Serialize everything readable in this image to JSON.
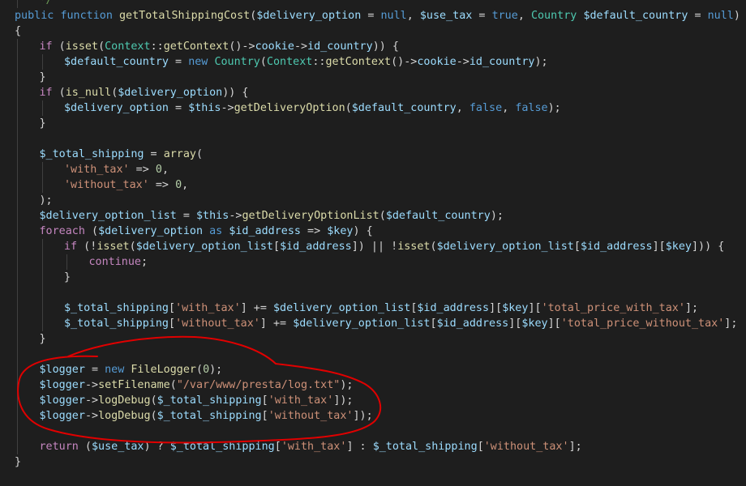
{
  "editor": {
    "theme": "dark",
    "background": "#1e1e1e",
    "colors": {
      "keyword": "#569cd6",
      "function": "#dcdcaa",
      "variable": "#9cdcfe",
      "class": "#4ec9b0",
      "string": "#ce9178",
      "number": "#b5cea8",
      "comment": "#6a9955",
      "annotation_stroke": "#e00000"
    },
    "lines": [
      {
        "indent": 1,
        "guides": [
          1
        ],
        "tokens": [
          [
            "cmt",
            "*/"
          ]
        ]
      },
      {
        "indent": 0,
        "guides": [],
        "tokens": [
          [
            "kw",
            "public"
          ],
          [
            "pl",
            " "
          ],
          [
            "kw",
            "function"
          ],
          [
            "pl",
            " "
          ],
          [
            "fn",
            "getTotalShippingCost"
          ],
          [
            "pl",
            "("
          ],
          [
            "var",
            "$delivery_option"
          ],
          [
            "pl",
            " = "
          ],
          [
            "kw",
            "null"
          ],
          [
            "pl",
            ", "
          ],
          [
            "var",
            "$use_tax"
          ],
          [
            "pl",
            " = "
          ],
          [
            "kw",
            "true"
          ],
          [
            "pl",
            ", "
          ],
          [
            "cls",
            "Country"
          ],
          [
            "pl",
            " "
          ],
          [
            "var",
            "$default_country"
          ],
          [
            "pl",
            " = "
          ],
          [
            "kw",
            "null"
          ],
          [
            "pl",
            ")"
          ]
        ]
      },
      {
        "indent": 0,
        "guides": [],
        "tokens": [
          [
            "pl",
            "{"
          ]
        ]
      },
      {
        "indent": 1,
        "guides": [
          1
        ],
        "tokens": [
          [
            "ctl",
            "if"
          ],
          [
            "pl",
            " ("
          ],
          [
            "fn",
            "isset"
          ],
          [
            "pl",
            "("
          ],
          [
            "cls",
            "Context"
          ],
          [
            "pl",
            "::"
          ],
          [
            "fn",
            "getContext"
          ],
          [
            "pl",
            "()->"
          ],
          [
            "var",
            "cookie"
          ],
          [
            "pl",
            "->"
          ],
          [
            "var",
            "id_country"
          ],
          [
            "pl",
            ")) {"
          ]
        ]
      },
      {
        "indent": 2,
        "guides": [
          1,
          2
        ],
        "tokens": [
          [
            "var",
            "$default_country"
          ],
          [
            "pl",
            " = "
          ],
          [
            "kw",
            "new"
          ],
          [
            "pl",
            " "
          ],
          [
            "cls",
            "Country"
          ],
          [
            "pl",
            "("
          ],
          [
            "cls",
            "Context"
          ],
          [
            "pl",
            "::"
          ],
          [
            "fn",
            "getContext"
          ],
          [
            "pl",
            "()->"
          ],
          [
            "var",
            "cookie"
          ],
          [
            "pl",
            "->"
          ],
          [
            "var",
            "id_country"
          ],
          [
            "pl",
            ");"
          ]
        ]
      },
      {
        "indent": 1,
        "guides": [
          1
        ],
        "tokens": [
          [
            "pl",
            "}"
          ]
        ]
      },
      {
        "indent": 1,
        "guides": [
          1
        ],
        "tokens": [
          [
            "ctl",
            "if"
          ],
          [
            "pl",
            " ("
          ],
          [
            "fn",
            "is_null"
          ],
          [
            "pl",
            "("
          ],
          [
            "var",
            "$delivery_option"
          ],
          [
            "pl",
            ")) {"
          ]
        ]
      },
      {
        "indent": 2,
        "guides": [
          1,
          2
        ],
        "tokens": [
          [
            "var",
            "$delivery_option"
          ],
          [
            "pl",
            " = "
          ],
          [
            "var",
            "$this"
          ],
          [
            "pl",
            "->"
          ],
          [
            "fn",
            "getDeliveryOption"
          ],
          [
            "pl",
            "("
          ],
          [
            "var",
            "$default_country"
          ],
          [
            "pl",
            ", "
          ],
          [
            "kw",
            "false"
          ],
          [
            "pl",
            ", "
          ],
          [
            "kw",
            "false"
          ],
          [
            "pl",
            ");"
          ]
        ]
      },
      {
        "indent": 1,
        "guides": [
          1
        ],
        "tokens": [
          [
            "pl",
            "}"
          ]
        ]
      },
      {
        "indent": 0,
        "guides": [
          1
        ],
        "tokens": []
      },
      {
        "indent": 1,
        "guides": [
          1
        ],
        "tokens": [
          [
            "var",
            "$_total_shipping"
          ],
          [
            "pl",
            " = "
          ],
          [
            "fn",
            "array"
          ],
          [
            "pl",
            "("
          ]
        ]
      },
      {
        "indent": 2,
        "guides": [
          1,
          2
        ],
        "tokens": [
          [
            "str",
            "'with_tax'"
          ],
          [
            "pl",
            " => "
          ],
          [
            "num",
            "0"
          ],
          [
            "pl",
            ","
          ]
        ]
      },
      {
        "indent": 2,
        "guides": [
          1,
          2
        ],
        "tokens": [
          [
            "str",
            "'without_tax'"
          ],
          [
            "pl",
            " => "
          ],
          [
            "num",
            "0"
          ],
          [
            "pl",
            ","
          ]
        ]
      },
      {
        "indent": 1,
        "guides": [
          1
        ],
        "tokens": [
          [
            "pl",
            ");"
          ]
        ]
      },
      {
        "indent": 1,
        "guides": [
          1
        ],
        "tokens": [
          [
            "var",
            "$delivery_option_list"
          ],
          [
            "pl",
            " = "
          ],
          [
            "var",
            "$this"
          ],
          [
            "pl",
            "->"
          ],
          [
            "fn",
            "getDeliveryOptionList"
          ],
          [
            "pl",
            "("
          ],
          [
            "var",
            "$default_country"
          ],
          [
            "pl",
            ");"
          ]
        ]
      },
      {
        "indent": 1,
        "guides": [
          1
        ],
        "tokens": [
          [
            "ctl",
            "foreach"
          ],
          [
            "pl",
            " ("
          ],
          [
            "var",
            "$delivery_option"
          ],
          [
            "pl",
            " "
          ],
          [
            "kw",
            "as"
          ],
          [
            "pl",
            " "
          ],
          [
            "var",
            "$id_address"
          ],
          [
            "pl",
            " => "
          ],
          [
            "var",
            "$key"
          ],
          [
            "pl",
            ") {"
          ]
        ]
      },
      {
        "indent": 2,
        "guides": [
          1,
          2
        ],
        "tokens": [
          [
            "ctl",
            "if"
          ],
          [
            "pl",
            " (!"
          ],
          [
            "fn",
            "isset"
          ],
          [
            "pl",
            "("
          ],
          [
            "var",
            "$delivery_option_list"
          ],
          [
            "pl",
            "["
          ],
          [
            "var",
            "$id_address"
          ],
          [
            "pl",
            "]) || !"
          ],
          [
            "fn",
            "isset"
          ],
          [
            "pl",
            "("
          ],
          [
            "var",
            "$delivery_option_list"
          ],
          [
            "pl",
            "["
          ],
          [
            "var",
            "$id_address"
          ],
          [
            "pl",
            "]["
          ],
          [
            "var",
            "$key"
          ],
          [
            "pl",
            "])) {"
          ]
        ]
      },
      {
        "indent": 3,
        "guides": [
          1,
          2,
          3
        ],
        "tokens": [
          [
            "ctl",
            "continue"
          ],
          [
            "pl",
            ";"
          ]
        ]
      },
      {
        "indent": 2,
        "guides": [
          1,
          2
        ],
        "tokens": [
          [
            "pl",
            "}"
          ]
        ]
      },
      {
        "indent": 0,
        "guides": [
          1,
          2
        ],
        "tokens": []
      },
      {
        "indent": 2,
        "guides": [
          1,
          2
        ],
        "tokens": [
          [
            "var",
            "$_total_shipping"
          ],
          [
            "pl",
            "["
          ],
          [
            "str",
            "'with_tax'"
          ],
          [
            "pl",
            "] += "
          ],
          [
            "var",
            "$delivery_option_list"
          ],
          [
            "pl",
            "["
          ],
          [
            "var",
            "$id_address"
          ],
          [
            "pl",
            "]["
          ],
          [
            "var",
            "$key"
          ],
          [
            "pl",
            "]["
          ],
          [
            "str",
            "'total_price_with_tax'"
          ],
          [
            "pl",
            "];"
          ]
        ]
      },
      {
        "indent": 2,
        "guides": [
          1,
          2
        ],
        "tokens": [
          [
            "var",
            "$_total_shipping"
          ],
          [
            "pl",
            "["
          ],
          [
            "str",
            "'without_tax'"
          ],
          [
            "pl",
            "] += "
          ],
          [
            "var",
            "$delivery_option_list"
          ],
          [
            "pl",
            "["
          ],
          [
            "var",
            "$id_address"
          ],
          [
            "pl",
            "]["
          ],
          [
            "var",
            "$key"
          ],
          [
            "pl",
            "]["
          ],
          [
            "str",
            "'total_price_without_tax'"
          ],
          [
            "pl",
            "];"
          ]
        ]
      },
      {
        "indent": 1,
        "guides": [
          1
        ],
        "tokens": [
          [
            "pl",
            "}"
          ]
        ]
      },
      {
        "indent": 0,
        "guides": [
          1
        ],
        "tokens": []
      },
      {
        "indent": 1,
        "guides": [
          1
        ],
        "tokens": [
          [
            "var",
            "$logger"
          ],
          [
            "pl",
            " = "
          ],
          [
            "kw",
            "new"
          ],
          [
            "pl",
            " "
          ],
          [
            "fn",
            "FileLogger"
          ],
          [
            "pl",
            "("
          ],
          [
            "num",
            "0"
          ],
          [
            "pl",
            ");"
          ]
        ]
      },
      {
        "indent": 1,
        "guides": [
          1
        ],
        "tokens": [
          [
            "var",
            "$logger"
          ],
          [
            "pl",
            "->"
          ],
          [
            "fn",
            "setFilename"
          ],
          [
            "pl",
            "("
          ],
          [
            "str",
            "\"/var/www/presta/log.txt\""
          ],
          [
            "pl",
            ");"
          ]
        ]
      },
      {
        "indent": 1,
        "guides": [
          1
        ],
        "tokens": [
          [
            "var",
            "$logger"
          ],
          [
            "pl",
            "->"
          ],
          [
            "fn",
            "logDebug"
          ],
          [
            "pl",
            "("
          ],
          [
            "var",
            "$_total_shipping"
          ],
          [
            "pl",
            "["
          ],
          [
            "str",
            "'with_tax'"
          ],
          [
            "pl",
            "]);"
          ]
        ]
      },
      {
        "indent": 1,
        "guides": [
          1
        ],
        "tokens": [
          [
            "var",
            "$logger"
          ],
          [
            "pl",
            "->"
          ],
          [
            "fn",
            "logDebug"
          ],
          [
            "pl",
            "("
          ],
          [
            "var",
            "$_total_shipping"
          ],
          [
            "pl",
            "["
          ],
          [
            "str",
            "'without_tax'"
          ],
          [
            "pl",
            "]);"
          ]
        ]
      },
      {
        "indent": 0,
        "guides": [
          1
        ],
        "tokens": []
      },
      {
        "indent": 1,
        "guides": [
          1
        ],
        "tokens": [
          [
            "ctl",
            "return"
          ],
          [
            "pl",
            " ("
          ],
          [
            "var",
            "$use_tax"
          ],
          [
            "pl",
            ") ? "
          ],
          [
            "var",
            "$_total_shipping"
          ],
          [
            "pl",
            "["
          ],
          [
            "str",
            "'with_tax'"
          ],
          [
            "pl",
            "] : "
          ],
          [
            "var",
            "$_total_shipping"
          ],
          [
            "pl",
            "["
          ],
          [
            "str",
            "'without_tax'"
          ],
          [
            "pl",
            "];"
          ]
        ]
      },
      {
        "indent": 0,
        "guides": [],
        "tokens": [
          [
            "pl",
            "}"
          ]
        ]
      },
      {
        "indent": 0,
        "guides": [],
        "tokens": []
      }
    ]
  }
}
